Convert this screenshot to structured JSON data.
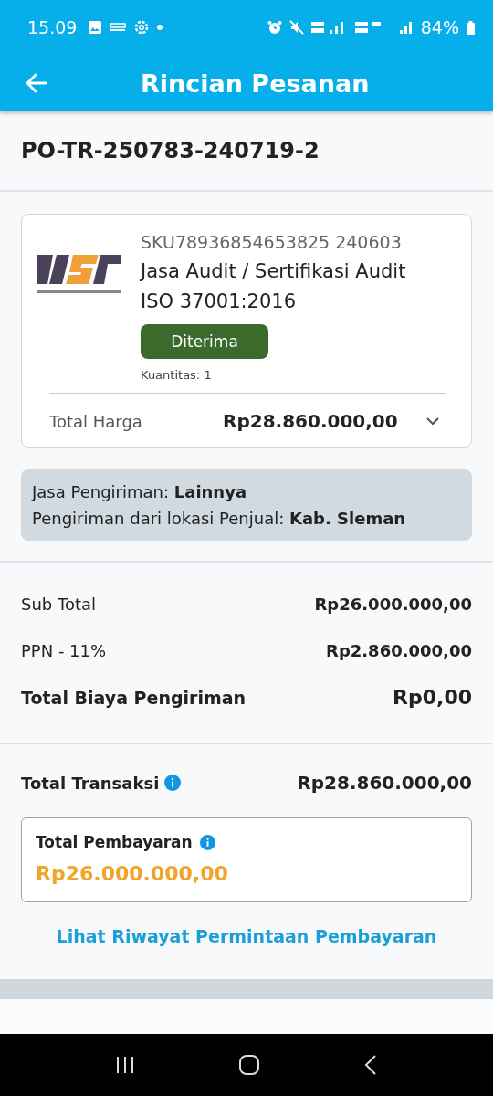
{
  "status_bar": {
    "time": "15.09",
    "battery": "84%"
  },
  "header": {
    "title": "Rincian Pesanan"
  },
  "order": {
    "number": "PO-TR-250783-240719-2"
  },
  "product": {
    "sku": "SKU78936854653825 240603",
    "name": "Jasa Audit / Sertifikasi Audit ISO 37001:2016",
    "status": "Diterima",
    "quantity": "Kuantitas: 1",
    "total_label": "Total Harga",
    "total_value": "Rp28.860.000,00",
    "expanded": false
  },
  "shipping": [
    "Jasa Pengiriman: **Lainnya**",
    "Pengiriman dari lokasi Penjual: **Kab. Sleman**"
  ],
  "summary": [
    {
      "label": "Sub Total",
      "value": "Rp26.000.000,00",
      "bold": false
    },
    {
      "label": "PPN - 11%",
      "value": "Rp2.860.000,00",
      "bold": false
    },
    {
      "label": "Total Biaya Pengiriman",
      "value": "Rp0,00",
      "bold": true
    }
  ],
  "transaction": {
    "label": "Total Transaksi",
    "value": "Rp28.860.000,00"
  },
  "payment": {
    "label": "Total Pembayaran",
    "value": "Rp26.000.000,00"
  },
  "link": "Lihat Riwayat Permintaan Pembayaran"
}
